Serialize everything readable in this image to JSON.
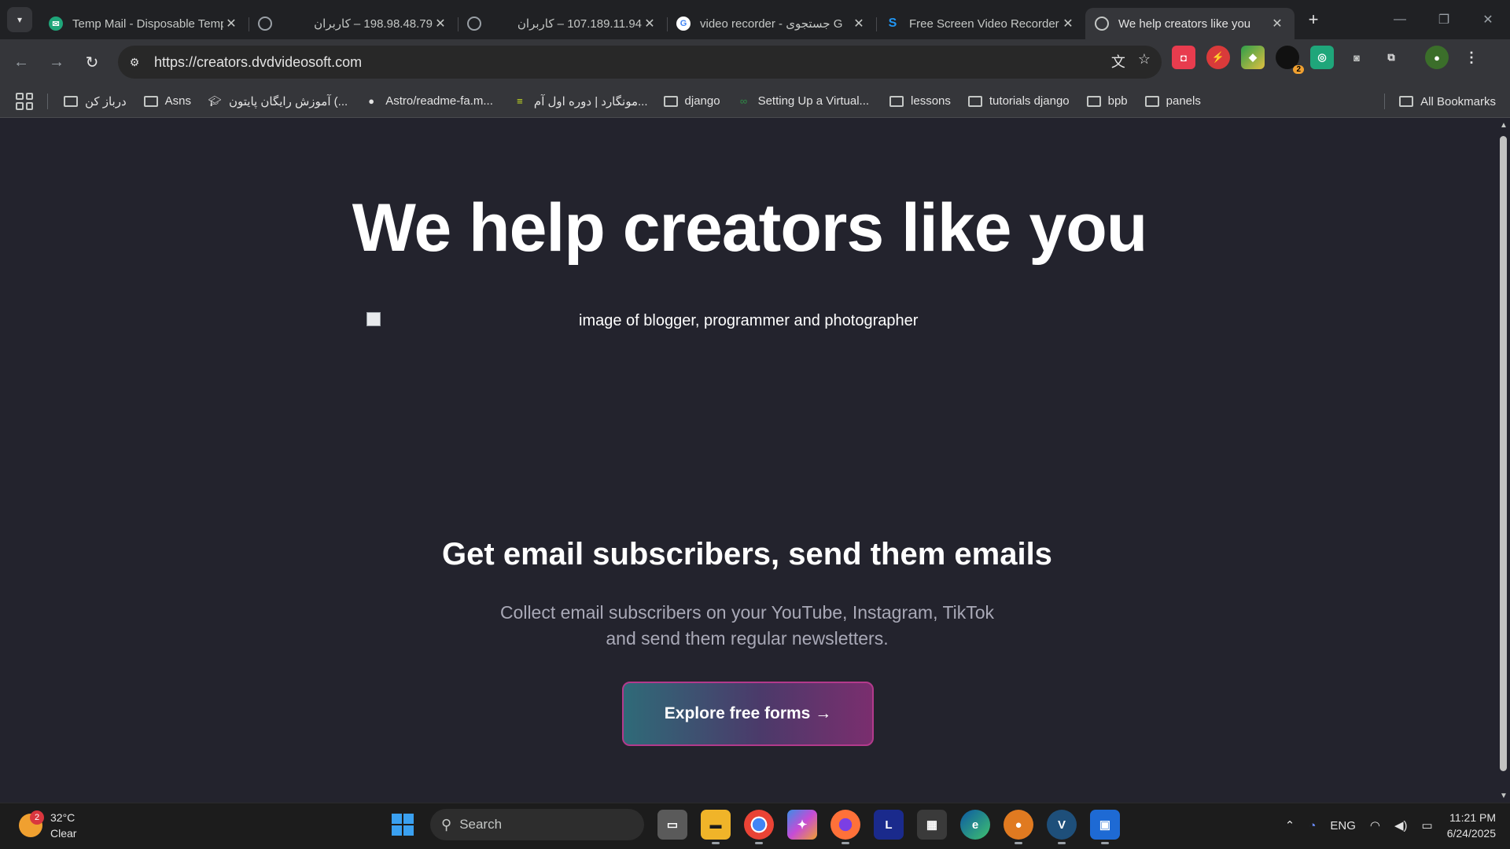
{
  "browser": {
    "tabs": [
      {
        "title": "Temp Mail - Disposable Temporary Email",
        "favicon": "tempmail-icon",
        "favcolor": "#1fa67a",
        "active": false
      },
      {
        "title": "198.98.48.79 – کاربران",
        "favicon": "globe-icon",
        "favcolor": "#9aa0a6",
        "active": false
      },
      {
        "title": "107.189.11.94 – کاربران",
        "favicon": "globe-icon",
        "favcolor": "#9aa0a6",
        "active": false
      },
      {
        "title": "video recorder - جستجوی G",
        "favicon": "google-icon",
        "favcolor": "#4285f4",
        "active": false
      },
      {
        "title": "Free Screen Video Recorder",
        "favicon": "dvdvideosoft-icon",
        "favcolor": "#2196f3",
        "active": false
      },
      {
        "title": "We help creators like you",
        "favicon": "globe-icon",
        "favcolor": "#9aa0a6",
        "active": true
      }
    ],
    "url": "https://creators.dvdvideosoft.com",
    "bookmarks": [
      {
        "label": "درباز کن",
        "type": "folder"
      },
      {
        "label": "Asns",
        "type": "folder"
      },
      {
        "label": "آموزش رایگان پایتون (...",
        "type": "site"
      },
      {
        "label": "Astro/readme-fa.m...",
        "type": "github"
      },
      {
        "label": "مونگارد | دوره اول آم...",
        "type": "site"
      },
      {
        "label": "django",
        "type": "folder"
      },
      {
        "label": "Setting Up a Virtual...",
        "type": "site"
      },
      {
        "label": "lessons",
        "type": "folder"
      },
      {
        "label": "tutorials django",
        "type": "folder"
      },
      {
        "label": "bpb",
        "type": "folder"
      },
      {
        "label": "panels",
        "type": "folder"
      }
    ],
    "all_bookmarks": "All Bookmarks",
    "extension_badge": "2"
  },
  "page": {
    "hero_title": "We help creators like you",
    "image_alt": "image of blogger, programmer and photographer",
    "subtitle": "Get email subscribers, send them emails",
    "description_line1": "Collect email subscribers on your YouTube, Instagram, TikTok",
    "description_line2": "and send them regular newsletters.",
    "cta_label": "Explore free forms →"
  },
  "taskbar": {
    "weather_temp": "32°C",
    "weather_desc": "Clear",
    "weather_badge": "2",
    "search_label": "Search",
    "language": "ENG",
    "time": "11:21 PM",
    "date": "6/24/2025"
  }
}
